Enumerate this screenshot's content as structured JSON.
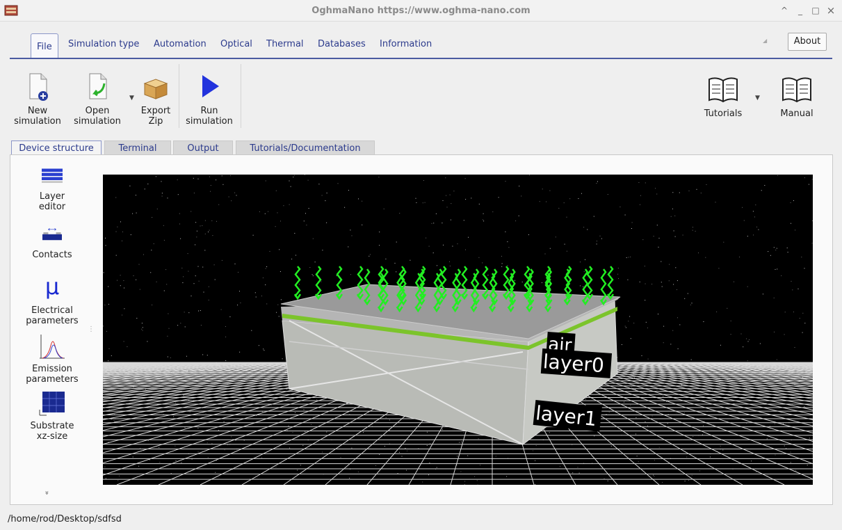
{
  "window": {
    "title": "OghmaNano https://www.oghma-nano.com",
    "controls": [
      "^",
      "_",
      "□",
      "×"
    ]
  },
  "menu": {
    "tabs": [
      "File",
      "Simulation type",
      "Automation",
      "Optical",
      "Thermal",
      "Databases",
      "Information"
    ],
    "active": "File",
    "about_label": "About"
  },
  "toolbar": {
    "new_label": "New\nsimulation",
    "open_label": "Open\nsimulation",
    "export_label": "Export\nZip",
    "run_label": "Run\nsimulation",
    "tutorials_label": "Tutorials",
    "manual_label": "Manual"
  },
  "subtabs": {
    "items": [
      "Device structure",
      "Terminal",
      "Output",
      "Tutorials/Documentation"
    ],
    "active": "Device structure"
  },
  "sidebar": {
    "items": [
      {
        "label": "Layer\neditor",
        "icon": "layer-editor-icon"
      },
      {
        "label": "Contacts",
        "icon": "contacts-icon"
      },
      {
        "label": "Electrical\nparameters",
        "icon": "mu-icon"
      },
      {
        "label": "Emission\nparameters",
        "icon": "emission-icon"
      },
      {
        "label": "Substrate\nxz-size",
        "icon": "substrate-icon"
      }
    ],
    "more_glyph": "»"
  },
  "viewport": {
    "labels": [
      "air",
      "layer0",
      "layer1"
    ],
    "mu_glyph": "μ"
  },
  "status": {
    "path": "/home/rod/Desktop/sdfsd"
  },
  "colors": {
    "accent": "#2b3a8c",
    "arrow_green": "#22ee22",
    "background": "#000000"
  }
}
